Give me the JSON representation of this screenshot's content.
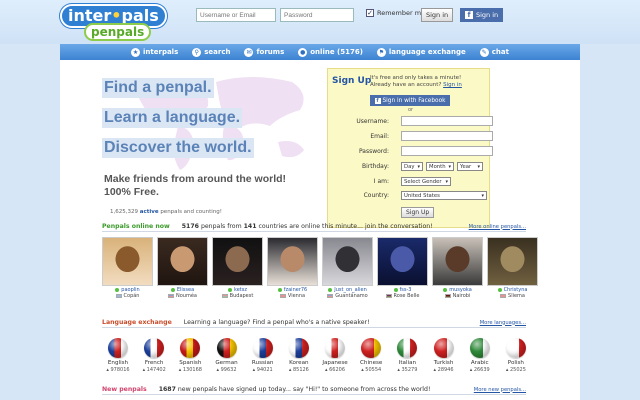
{
  "header": {
    "logo_main": "inter",
    "logo_dot": "•",
    "logo_main2": "pals",
    "logo_sub": "penpals",
    "username_placeholder": "Username or Email",
    "password_placeholder": "Password",
    "remember_label": "Remember me",
    "signin_label": "Sign in",
    "fb_signin_label": "Sign in"
  },
  "nav": [
    {
      "label": "interpals",
      "icon": "home-icon",
      "glyph": "★"
    },
    {
      "label": "search",
      "icon": "search-icon",
      "glyph": "⚲"
    },
    {
      "label": "forums",
      "icon": "forums-icon",
      "glyph": "✉"
    },
    {
      "label": "online (5176)",
      "icon": "online-icon",
      "glyph": "●"
    },
    {
      "label": "language exchange",
      "icon": "language-icon",
      "glyph": "⚑"
    },
    {
      "label": "chat",
      "icon": "chat-icon",
      "glyph": "✎"
    }
  ],
  "hero": {
    "line1": "Find a penpal.",
    "line2": "Learn a language.",
    "line3": "Discover the world.",
    "sub1": "Make friends from around the world!",
    "sub2": "100% Free.",
    "count_number": "1,625,329",
    "count_bold": "active",
    "count_text": "penpals and counting!"
  },
  "signup": {
    "title": "Sign Up",
    "intro1": "It's free and only takes a minute!",
    "intro2": "Already have an account?",
    "intro_link": "Sign in",
    "fb_label": "Sign in with Facebook",
    "or": "or",
    "username_label": "Username:",
    "email_label": "Email:",
    "password_label": "Password:",
    "birthday_label": "Birthday:",
    "day": "Day",
    "month": "Month",
    "year": "Year",
    "iam_label": "I am:",
    "gender": "Select Gender",
    "country_label": "Country:",
    "country": "United States",
    "submit": "Sign Up"
  },
  "online": {
    "title": "Penpals online now",
    "count": "5176",
    "text1": "penpals from",
    "countries": "141",
    "text2": "countries are online this minute... join the conversation!",
    "more": "More online penpals...",
    "people": [
      {
        "name": "paoplin",
        "city": "Copán",
        "colors": [
          "#3a6fb8",
          "#ffffff",
          "#3a6fb8"
        ],
        "photo": [
          "#d9b27a",
          "#8a5a2c",
          "#f2dcc0"
        ]
      },
      {
        "name": "Elissea",
        "city": "Nouméa",
        "colors": [
          "#1d3f9a",
          "#ffffff",
          "#d02020"
        ],
        "photo": [
          "#3a2a20",
          "#c99a72",
          "#201510"
        ]
      },
      {
        "name": "ketsz",
        "city": "Budapest",
        "colors": [
          "#cc2929",
          "#ffffff",
          "#2f8a3a"
        ],
        "photo": [
          "#111111",
          "#8c6a50",
          "#2a2020"
        ]
      },
      {
        "name": "fzainer76",
        "city": "Vienna",
        "colors": [
          "#d02020",
          "#ffffff",
          "#d02020"
        ],
        "photo": [
          "#2a2a30",
          "#b88a6a",
          "#e8e0d8"
        ]
      },
      {
        "name": "Just_on_alien",
        "city": "Guantánamo",
        "colors": [
          "#1d3f9a",
          "#ffffff",
          "#d02020"
        ],
        "photo": [
          "#888890",
          "#303035",
          "#d8d8dc"
        ]
      },
      {
        "name": "fss-3",
        "city": "Rose Belle",
        "colors": [
          "#d02020",
          "#1d3f9a",
          "#f5c400"
        ],
        "photo": [
          "#1a2a6a",
          "#4a5aa8",
          "#0a1030"
        ]
      },
      {
        "name": "musyoka",
        "city": "Nairobi",
        "colors": [
          "#111111",
          "#c02020",
          "#2f8a3a"
        ],
        "photo": [
          "#c8c0b8",
          "#5a3a28",
          "#3a3a3a"
        ]
      },
      {
        "name": "Christyna",
        "city": "Sliema",
        "colors": [
          "#ffffff",
          "#d02020",
          "#ffffff"
        ],
        "photo": [
          "#3a3020",
          "#a08a60",
          "#706040"
        ]
      }
    ]
  },
  "language": {
    "title": "Language exchange",
    "text": "Learning a language? Find a penpal who's a native speaker!",
    "more": "More languages...",
    "items": [
      {
        "name": "English",
        "count": "978016",
        "colors": [
          "#1d3f9a",
          "#d02020",
          "#ffffff"
        ]
      },
      {
        "name": "French",
        "count": "147402",
        "colors": [
          "#1d3f9a",
          "#ffffff",
          "#d02020"
        ]
      },
      {
        "name": "Spanish",
        "count": "130168",
        "colors": [
          "#c61a1a",
          "#f5c400",
          "#c61a1a"
        ]
      },
      {
        "name": "German",
        "count": "99632",
        "colors": [
          "#111111",
          "#d02020",
          "#f5c400"
        ]
      },
      {
        "name": "Russian",
        "count": "94021",
        "colors": [
          "#ffffff",
          "#1d3f9a",
          "#d02020"
        ]
      },
      {
        "name": "Korean",
        "count": "85126",
        "colors": [
          "#ffffff",
          "#1d3f9a",
          "#d02020"
        ]
      },
      {
        "name": "Japanese",
        "count": "66206",
        "colors": [
          "#ffffff",
          "#d02020",
          "#ffffff"
        ]
      },
      {
        "name": "Chinese",
        "count": "50554",
        "colors": [
          "#d02020",
          "#d02020",
          "#f5c400"
        ]
      },
      {
        "name": "Italian",
        "count": "35279",
        "colors": [
          "#2f8a3a",
          "#ffffff",
          "#d02020"
        ]
      },
      {
        "name": "Turkish",
        "count": "28946",
        "colors": [
          "#d02020",
          "#d02020",
          "#ffffff"
        ]
      },
      {
        "name": "Arabic",
        "count": "26639",
        "colors": [
          "#2f8a3a",
          "#2f8a3a",
          "#ffffff"
        ]
      },
      {
        "name": "Polish",
        "count": "25025",
        "colors": [
          "#ffffff",
          "#ffffff",
          "#d02020"
        ]
      }
    ]
  },
  "newpals": {
    "title": "New penpals",
    "count": "1687",
    "text": "new penpals have signed up today... say \"Hi!\" to someone from across the world!",
    "more": "More new penpals..."
  },
  "colors": {
    "accent": "#2f7fd3",
    "nav": "#3d83d2",
    "signup_bg": "#fbf9c6",
    "online_green": "#3a9a2a",
    "language_red": "#c94b2a",
    "new_pink": "#d0436d"
  }
}
